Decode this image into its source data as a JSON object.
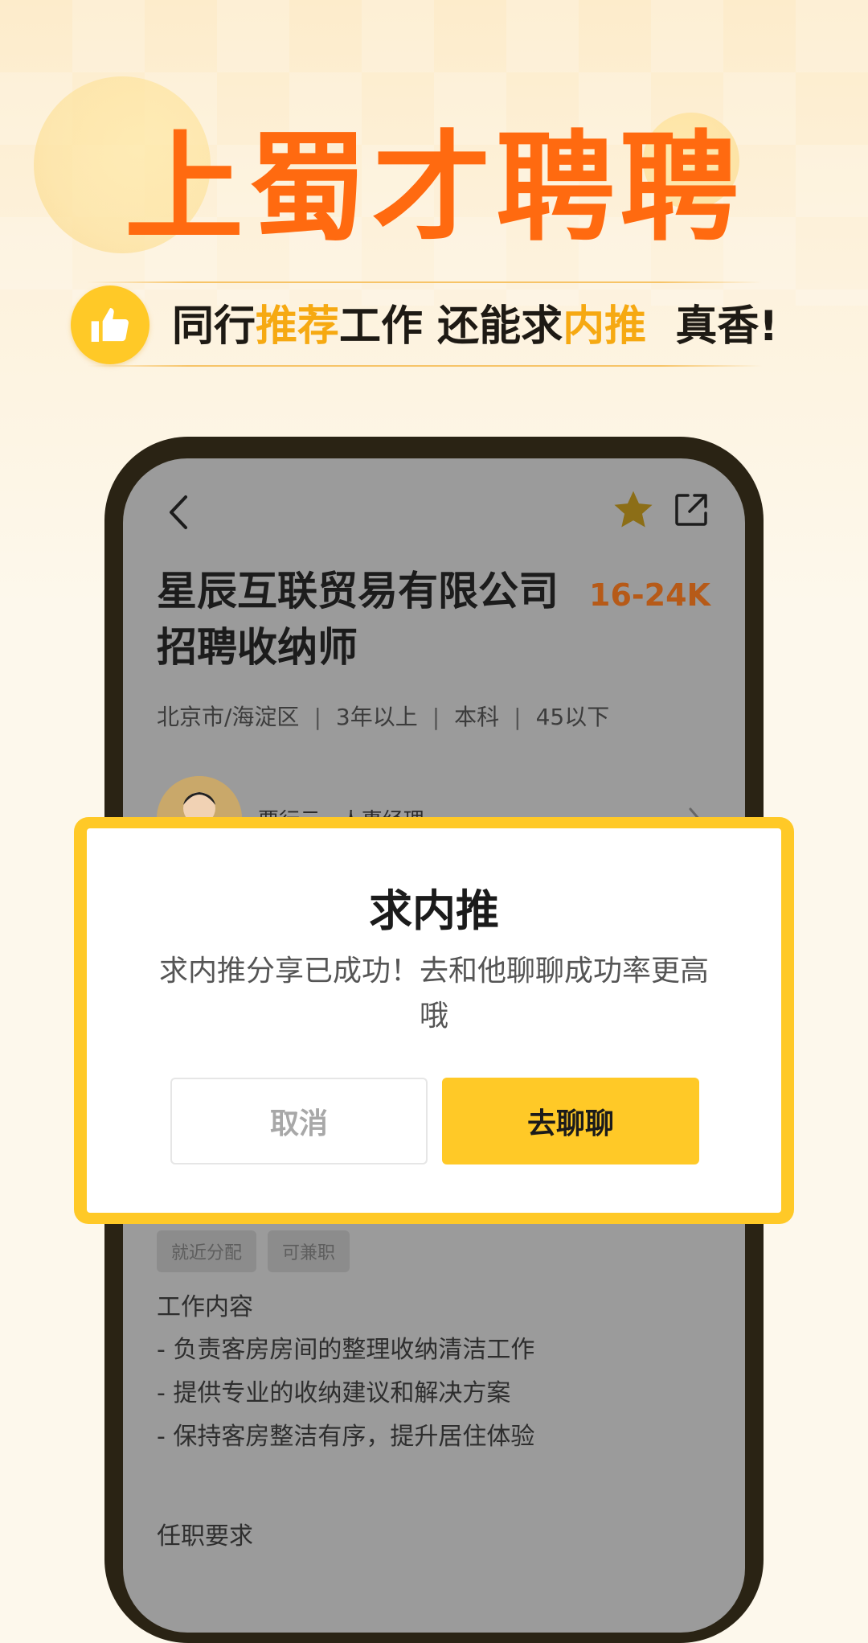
{
  "hero": {
    "title": "上蜀才聘聘",
    "tagline_parts": [
      "同行",
      "推荐",
      "工作 还能求",
      "内推",
      "  真香!"
    ]
  },
  "colors": {
    "title_orange": "#ff6a10",
    "accent_yellow": "#ffc927",
    "highlight_text": "#f6a912",
    "salary_text": "#b65a18",
    "phone_frame": "#2a2314"
  },
  "job": {
    "title": "星辰互联贸易有限公司招聘收纳师",
    "salary": "16-24K",
    "meta": [
      "北京市/海淀区",
      "3年以上",
      "本科",
      "45以下"
    ],
    "recruiter": "贾行云 · 人事经理",
    "tags": [
      "就近分配",
      "可兼职"
    ],
    "content_heading": "工作内容",
    "content_items": [
      "- 负责客房房间的整理收纳清洁工作",
      "- 提供专业的收纳建议和解决方案",
      "- 保持客房整洁有序，提升居住体验"
    ],
    "requirements_heading": "任职要求"
  },
  "icons": {
    "back": "chevron-left-icon",
    "favorite": "star-icon",
    "share": "share-icon",
    "thumb": "thumbs-up-icon"
  },
  "dialog": {
    "title": "求内推",
    "message": "求内推分享已成功！去和他聊聊成功率更高哦",
    "cancel_label": "取消",
    "confirm_label": "去聊聊"
  }
}
